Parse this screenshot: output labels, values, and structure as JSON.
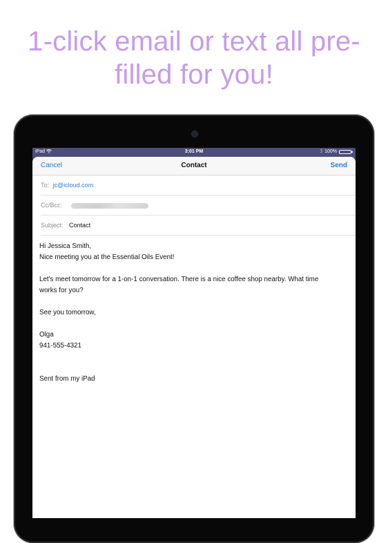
{
  "headline": {
    "line1": "1-click email or text all pre-",
    "line2": "filled for you!"
  },
  "colors": {
    "headline": "#c79bea",
    "accent": "#2a7bd8"
  },
  "status_bar": {
    "carrier": "iPad",
    "wifi_icon": "wifi-icon",
    "time": "3:01 PM",
    "battery": "100%",
    "battery_icon": "battery-icon"
  },
  "nav": {
    "cancel": "Cancel",
    "title": "Contact",
    "send": "Send"
  },
  "fields": {
    "to_label": "To:",
    "to_value": "jc@icloud.com",
    "ccbcc_label": "Cc/Bcc:",
    "subject_label": "Subject:",
    "subject_value": "Contact"
  },
  "body": {
    "greeting": "Hi Jessica Smith,",
    "line1": "Nice meeting you at the Essential Oils Event!",
    "para2a": "Let's meet tomorrow for a 1-on-1 conversation. There is a nice coffee shop nearby. What time",
    "para2b": "works for you?",
    "signoff": "See you tomorrow,",
    "name": "Olga",
    "phone": "941-555-4321",
    "signature": "Sent from my iPad"
  }
}
